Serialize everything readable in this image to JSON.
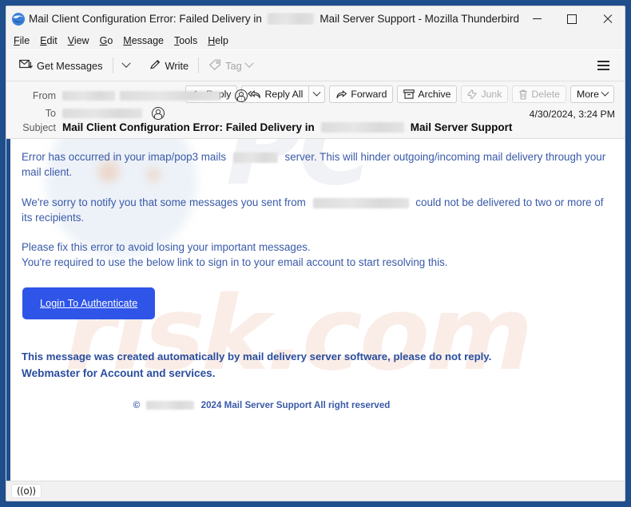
{
  "window": {
    "app_icon": "thunderbird-icon",
    "title_before_redaction": "Mail Client Configuration Error: Failed Delivery in",
    "title_after_redaction": "Mail Server Support - Mozilla Thunderbird",
    "controls": {
      "minimize": "minimize-button",
      "maximize": "maximize-button",
      "close": "close-button"
    }
  },
  "menubar": {
    "items": [
      {
        "label": "File",
        "accel": "F"
      },
      {
        "label": "Edit",
        "accel": "E"
      },
      {
        "label": "View",
        "accel": "V"
      },
      {
        "label": "Go",
        "accel": "G"
      },
      {
        "label": "Message",
        "accel": "M"
      },
      {
        "label": "Tools",
        "accel": "T"
      },
      {
        "label": "Help",
        "accel": "H"
      }
    ]
  },
  "toolbar": {
    "get_messages_label": "Get Messages",
    "write_label": "Write",
    "tag_label": "Tag",
    "app_menu_label": "App Menu"
  },
  "message_header": {
    "from_label": "From",
    "from_value": "",
    "to_label": "To",
    "to_value": "",
    "subject_label": "Subject",
    "subject_before_redaction": "Mail Client Configuration Error: Failed Delivery in",
    "subject_after_redaction": "Mail Server Support",
    "date": "4/30/2024, 3:24 PM",
    "actions": [
      {
        "label": "Reply",
        "icon": "reply-icon",
        "enabled": true
      },
      {
        "label": "Reply All",
        "icon": "reply-all-icon",
        "enabled": true
      },
      {
        "label": "Forward",
        "icon": "forward-icon",
        "enabled": true
      },
      {
        "label": "Archive",
        "icon": "archive-icon",
        "enabled": true
      },
      {
        "label": "Junk",
        "icon": "junk-icon",
        "enabled": false
      },
      {
        "label": "Delete",
        "icon": "trash-icon",
        "enabled": false
      },
      {
        "label": "More",
        "icon": "chevron-down-icon",
        "enabled": true
      }
    ]
  },
  "body": {
    "paragraph_1_part_1": "Error has occurred in your imap/pop3 mails",
    "paragraph_1_part_2": "server. This will hinder outgoing/incoming mail delivery through your mail client.",
    "paragraph_2_part_1": "We're sorry to notify you that some messages you sent from",
    "paragraph_2_part_2": "could not be delivered to two or more of its recipients.",
    "paragraph_3_line_1": "Please fix this error to avoid losing your important messages.",
    "paragraph_3_line_2": "You're required to use the below link to sign in to your email account to start resolving this.",
    "cta_label": "Login To Authenticate",
    "footer_line_1": "This message was created automatically by mail delivery server software, please do not reply.",
    "footer_line_2": "Webmaster for Account and services.",
    "copyright_prefix": "©",
    "copyright_suffix": "2024 Mail Server Support All right reserved",
    "watermark_text": "PCrisk.com"
  },
  "statusbar": {
    "online_indicator": "((o))"
  },
  "colors": {
    "window_border": "#1f4e8c",
    "body_text": "#3a5aa8",
    "footer_text": "#2a4d9e",
    "cta_background": "#2e55e8",
    "cta_text": "#ffffff",
    "chrome_background": "#f3f3f3"
  }
}
